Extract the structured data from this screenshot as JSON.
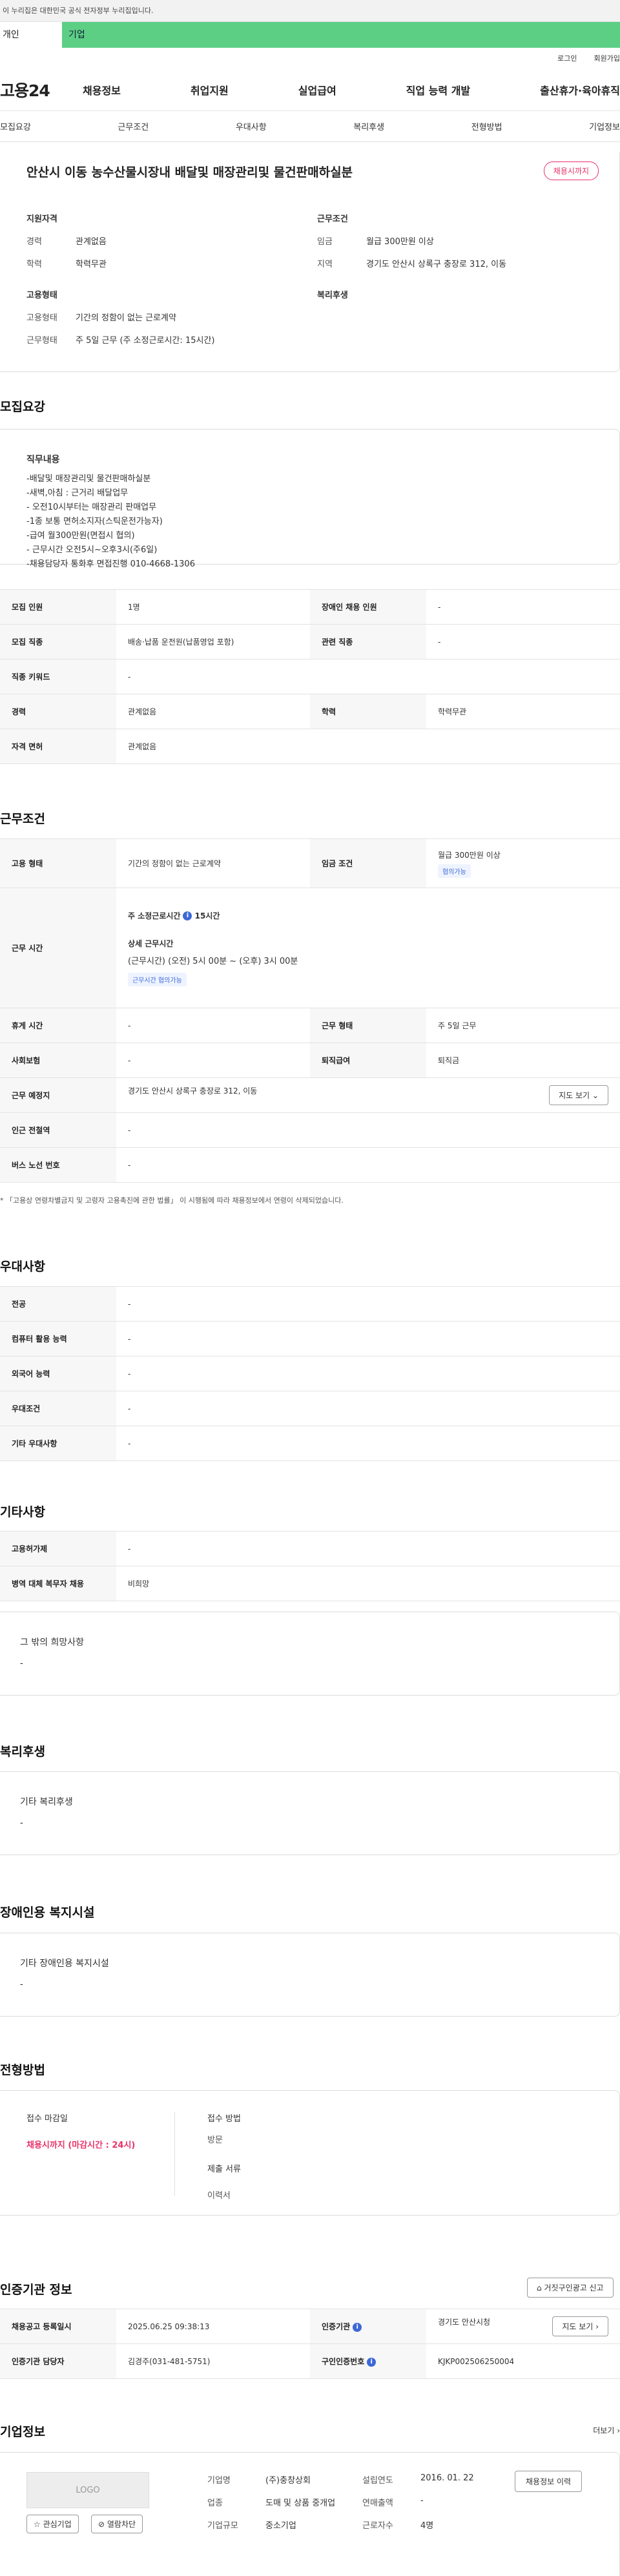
{
  "gov_banner": "이 누리집은 대한민국 공식 전자정부 누리집입니다.",
  "user_tabs": {
    "person": "개인",
    "company": "기업"
  },
  "util": {
    "login": "로그인",
    "join": "회원가입"
  },
  "gnb": {
    "logo": "고용24",
    "menu": [
      "채용정보",
      "취업지원",
      "실업급여",
      "직업 능력 개발",
      "출산휴가·육아휴직"
    ]
  },
  "subnav": [
    "모집요강",
    "근무조건",
    "우대사항",
    "복리후생",
    "전형방법",
    "기업정보"
  ],
  "job": {
    "title": "안산시 이동 농수산물시장내 배달및 매장관리및 물건판매하실분",
    "status_badge": "채용시까지",
    "qual_title": "지원자격",
    "career_k": "경력",
    "career_v": "관계없음",
    "edu_k": "학력",
    "edu_v": "학력무관",
    "cond_title": "근무조건",
    "wage_k": "임금",
    "wage_v": "월급 300만원 이상",
    "region_k": "지역",
    "region_v": "경기도 안산시 상록구 충장로 312, 이동",
    "emp_title": "고용형태",
    "emptype_k": "고용형태",
    "emptype_v": "기간의 정함이 없는 근로계약",
    "workform_k": "근무형태",
    "workform_v": "주 5일 근무 (주 소정근로시간: 15시간)",
    "welfare_title": "복리후생"
  },
  "recruit": {
    "section": "모집요강",
    "duty_title": "직무내용",
    "duty_text": "-배달및 매장관리및 물건판매하실분\n-새벽,아침 : 근거리 배달업무\n- 오전10시부터는 매장관리 판매업무\n-1종 보통 면허소지자(스틱운전가능자)\n-급여 월300만원(면접시 협의)\n- 근무시간 오전5시~오후3시(주6일)\n-채용담당자 통화후 면접진행 010-4668-1306",
    "rows": {
      "count_k": "모집 인원",
      "count_v": "1명",
      "disabled_k": "장애인 채용 인원",
      "disabled_v": "-",
      "job_k": "모집 직종",
      "job_v": "배송·납품 운전원(납품영업 포함)",
      "rel_k": "관련 직종",
      "rel_v": "-",
      "kw_k": "직종 키워드",
      "kw_v": "-",
      "career_k": "경력",
      "career_v": "관계없음",
      "edu_k": "학력",
      "edu_v": "학력무관",
      "license_k": "자격 면허",
      "license_v": "관계없음"
    }
  },
  "work": {
    "section": "근무조건",
    "emptype_k": "고용 형태",
    "emptype_v": "기간의 정함이 없는 근로계약",
    "wage_k": "임금 조건",
    "wage_v": "월급 300만원 이상",
    "wage_tag": "협의가능",
    "time_k": "근무 시간",
    "weekly_label": "주 소정근로시간",
    "weekly_v": "15시간",
    "detail_label": "상세 근무시간",
    "detail_v1": "(근무시간) (오전) 5시 00분 ~ (오후) 3시 00분",
    "detail_tag": "근무시간 협의가능",
    "rest_k": "휴게 시간",
    "rest_v": "-",
    "form_k": "근무 형태",
    "form_v": "주 5일 근무",
    "ins_k": "사회보험",
    "ins_v": "-",
    "sev_k": "퇴직급여",
    "sev_v": "퇴직금",
    "place_k": "근무 예정지",
    "place_v": "경기도 안산시 상록구 충장로 312, 이동",
    "map_btn": "지도 보기",
    "subway_k": "인근 전철역",
    "subway_v": "-",
    "bus_k": "버스 노선 번호",
    "bus_v": "-",
    "note": "* 「고용상 연령차별금지 및 고령자 고용촉진에 관한 법률」 이 시행됨에 따라 채용정보에서 연령이 삭제되었습니다."
  },
  "pref": {
    "section": "우대사항",
    "major_k": "전공",
    "major_v": "-",
    "pc_k": "컴퓨터 활용 능력",
    "pc_v": "-",
    "lang_k": "외국어 능력",
    "lang_v": "-",
    "cond_k": "우대조건",
    "cond_v": "-",
    "etc_k": "기타 우대사항",
    "etc_v": "-"
  },
  "etc": {
    "section": "기타사항",
    "perm_k": "고용허가제",
    "perm_v": "-",
    "army_k": "병역 대체 복무자 채용",
    "army_v": "비희망",
    "hope_title": "그 밖의 희망사항",
    "hope_v": "-"
  },
  "welfare": {
    "section": "복리후생",
    "title": "기타 복리후생",
    "value": "-"
  },
  "disabled_fac": {
    "section": "장애인용 복지시설",
    "title": "기타 장애인용 복지시설",
    "value": "-"
  },
  "selection": {
    "section": "전형방법",
    "deadline_label": "접수 마감일",
    "deadline_v": "채용시까지 (마감시간 : 24시)",
    "method_label": "접수 방법",
    "method_v": "방문",
    "docs_label": "제출 서류",
    "docs_v": "이력서"
  },
  "cert": {
    "section": "인증기관 정보",
    "report_btn": "거짓구인광고 신고",
    "reg_k": "채용공고 등록일시",
    "reg_v": "2025.06.25 09:38:13",
    "org_k": "인증기관",
    "org_v": "경기도 안산시청",
    "map_btn": "지도 보기",
    "staff_k": "인증기관 담당자",
    "staff_v": "김경주(031-481-5751)",
    "no_k": "구인인증번호",
    "no_v": "KJKP002506250004"
  },
  "company": {
    "section": "기업정보",
    "more": "더보기",
    "logo": "LOGO",
    "fav_btn": "관심기업",
    "block_btn": "열람차단",
    "name_k": "기업명",
    "name_v": "(주)충창상회",
    "ind_k": "업종",
    "ind_v": "도매 및 상품 중개업",
    "scale_k": "기업규모",
    "scale_v": "중소기업",
    "est_k": "설립연도",
    "est_v": "2016. 01. 22",
    "sales_k": "연매출액",
    "sales_v": "-",
    "emp_k": "근로자수",
    "emp_v": "4명",
    "jobs_btn": "채용정보 이력"
  }
}
